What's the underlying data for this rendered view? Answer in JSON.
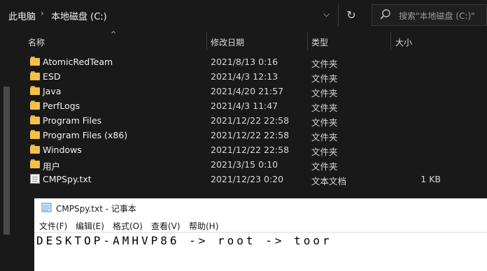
{
  "breadcrumb": {
    "root": "此电脑",
    "current": "本地磁盘 (C:)"
  },
  "search": {
    "placeholder": "搜索\"本地磁盘 (C:)\""
  },
  "columns": {
    "name": "名称",
    "date": "修改日期",
    "type": "类型",
    "size": "大小"
  },
  "files": [
    {
      "name": "AtomicRedTeam",
      "date": "2021/8/13 0:16",
      "type": "文件夹",
      "size": "",
      "icon": "folder"
    },
    {
      "name": "ESD",
      "date": "2021/4/3 12:13",
      "type": "文件夹",
      "size": "",
      "icon": "folder"
    },
    {
      "name": "Java",
      "date": "2021/4/20 21:57",
      "type": "文件夹",
      "size": "",
      "icon": "folder"
    },
    {
      "name": "PerfLogs",
      "date": "2021/4/3 11:47",
      "type": "文件夹",
      "size": "",
      "icon": "folder"
    },
    {
      "name": "Program Files",
      "date": "2021/12/22 22:58",
      "type": "文件夹",
      "size": "",
      "icon": "folder"
    },
    {
      "name": "Program Files (x86)",
      "date": "2021/12/22 22:58",
      "type": "文件夹",
      "size": "",
      "icon": "folder"
    },
    {
      "name": "Windows",
      "date": "2021/12/22 22:58",
      "type": "文件夹",
      "size": "",
      "icon": "folder"
    },
    {
      "name": "用户",
      "date": "2021/3/15 0:10",
      "type": "文件夹",
      "size": "",
      "icon": "folder"
    },
    {
      "name": "CMPSpy.txt",
      "date": "2021/12/23 0:20",
      "type": "文本文档",
      "size": "1 KB",
      "icon": "text-file"
    }
  ],
  "notepad": {
    "title": "CMPSpy.txt - 记事本",
    "menu": [
      "文件(F)",
      "编辑(E)",
      "格式(O)",
      "查看(V)",
      "帮助(H)"
    ],
    "content": "DESKTOP-AMHVP86 -> root -> toor"
  },
  "colors": {
    "background": "#191919",
    "folder": "#f3c14a",
    "notepad_bg": "#ffffff"
  }
}
